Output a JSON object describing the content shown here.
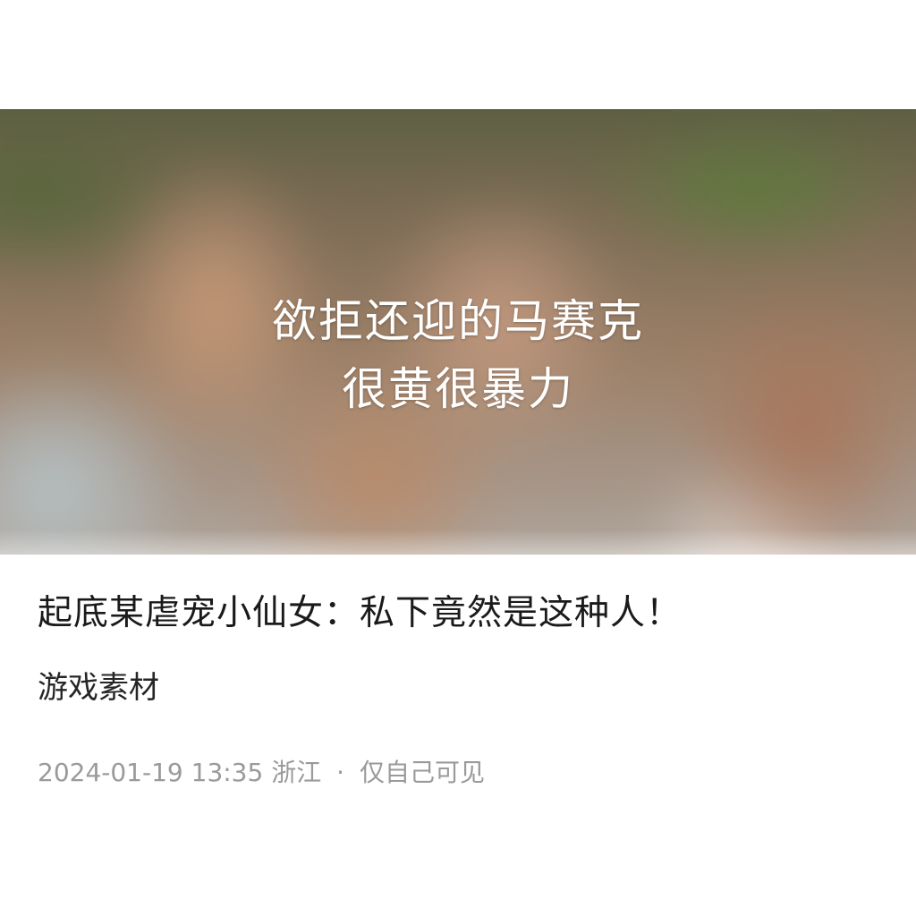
{
  "cover": {
    "line1": "欲拒还迎的马赛克",
    "line2": "很黄很暴力"
  },
  "post": {
    "title": "起底某虐宠小仙女：私下竟然是这种人！",
    "tag": "游戏素材",
    "timestamp": "2024-01-19 13:35",
    "location": "浙江",
    "separator": "·",
    "visibility": "仅自己可见"
  }
}
